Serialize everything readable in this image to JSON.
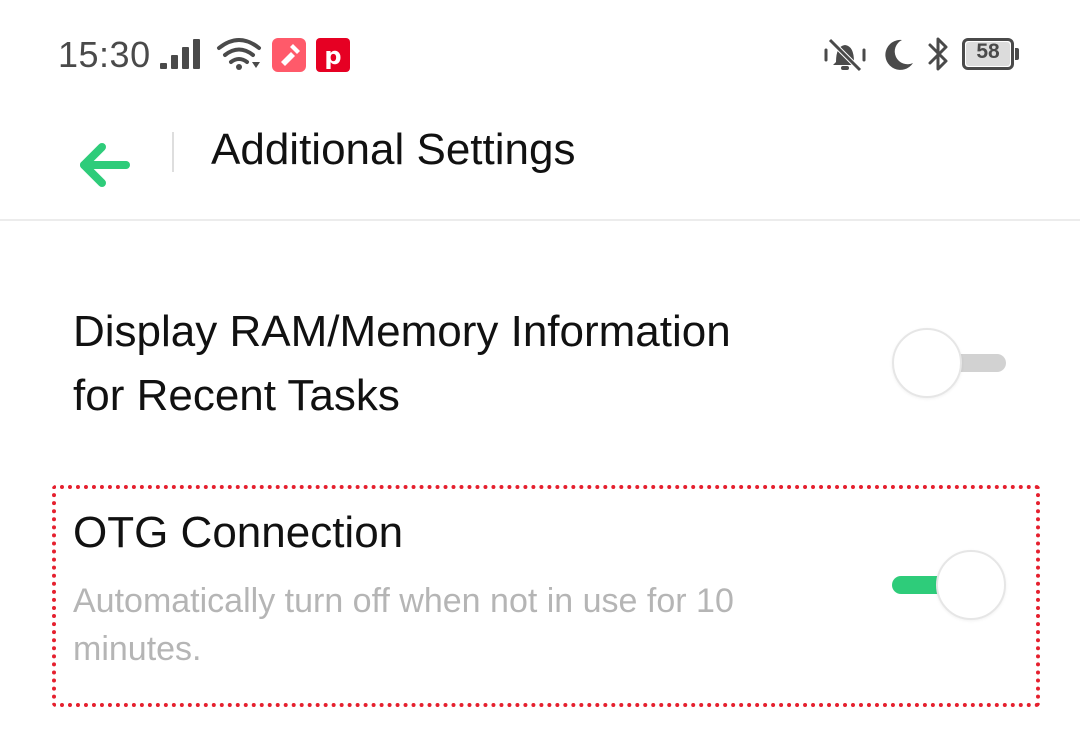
{
  "status_bar": {
    "time": "15:30",
    "battery_level": "58",
    "icons": [
      "signal-icon",
      "wifi-icon",
      "app-notification-icon",
      "pinterest-icon",
      "vibrate-icon",
      "do-not-disturb-icon",
      "bluetooth-icon",
      "battery-icon"
    ]
  },
  "header": {
    "title": "Additional Settings",
    "back_icon": "back-arrow-icon"
  },
  "settings": {
    "ram_info": {
      "title_line1": "Display RAM/Memory Information",
      "title_line2": "for Recent Tasks",
      "enabled": false
    },
    "otg": {
      "title": "OTG Connection",
      "subtitle_line1": "Automatically turn off when not in use for 10",
      "subtitle_line2": "minutes.",
      "enabled": true
    }
  },
  "colors": {
    "accent": "#2ecc7a",
    "highlight": "#e5202e",
    "toggle_off_track": "#d2d2d2",
    "pinterest": "#e60023",
    "app_notification": "#ff5a6a"
  }
}
